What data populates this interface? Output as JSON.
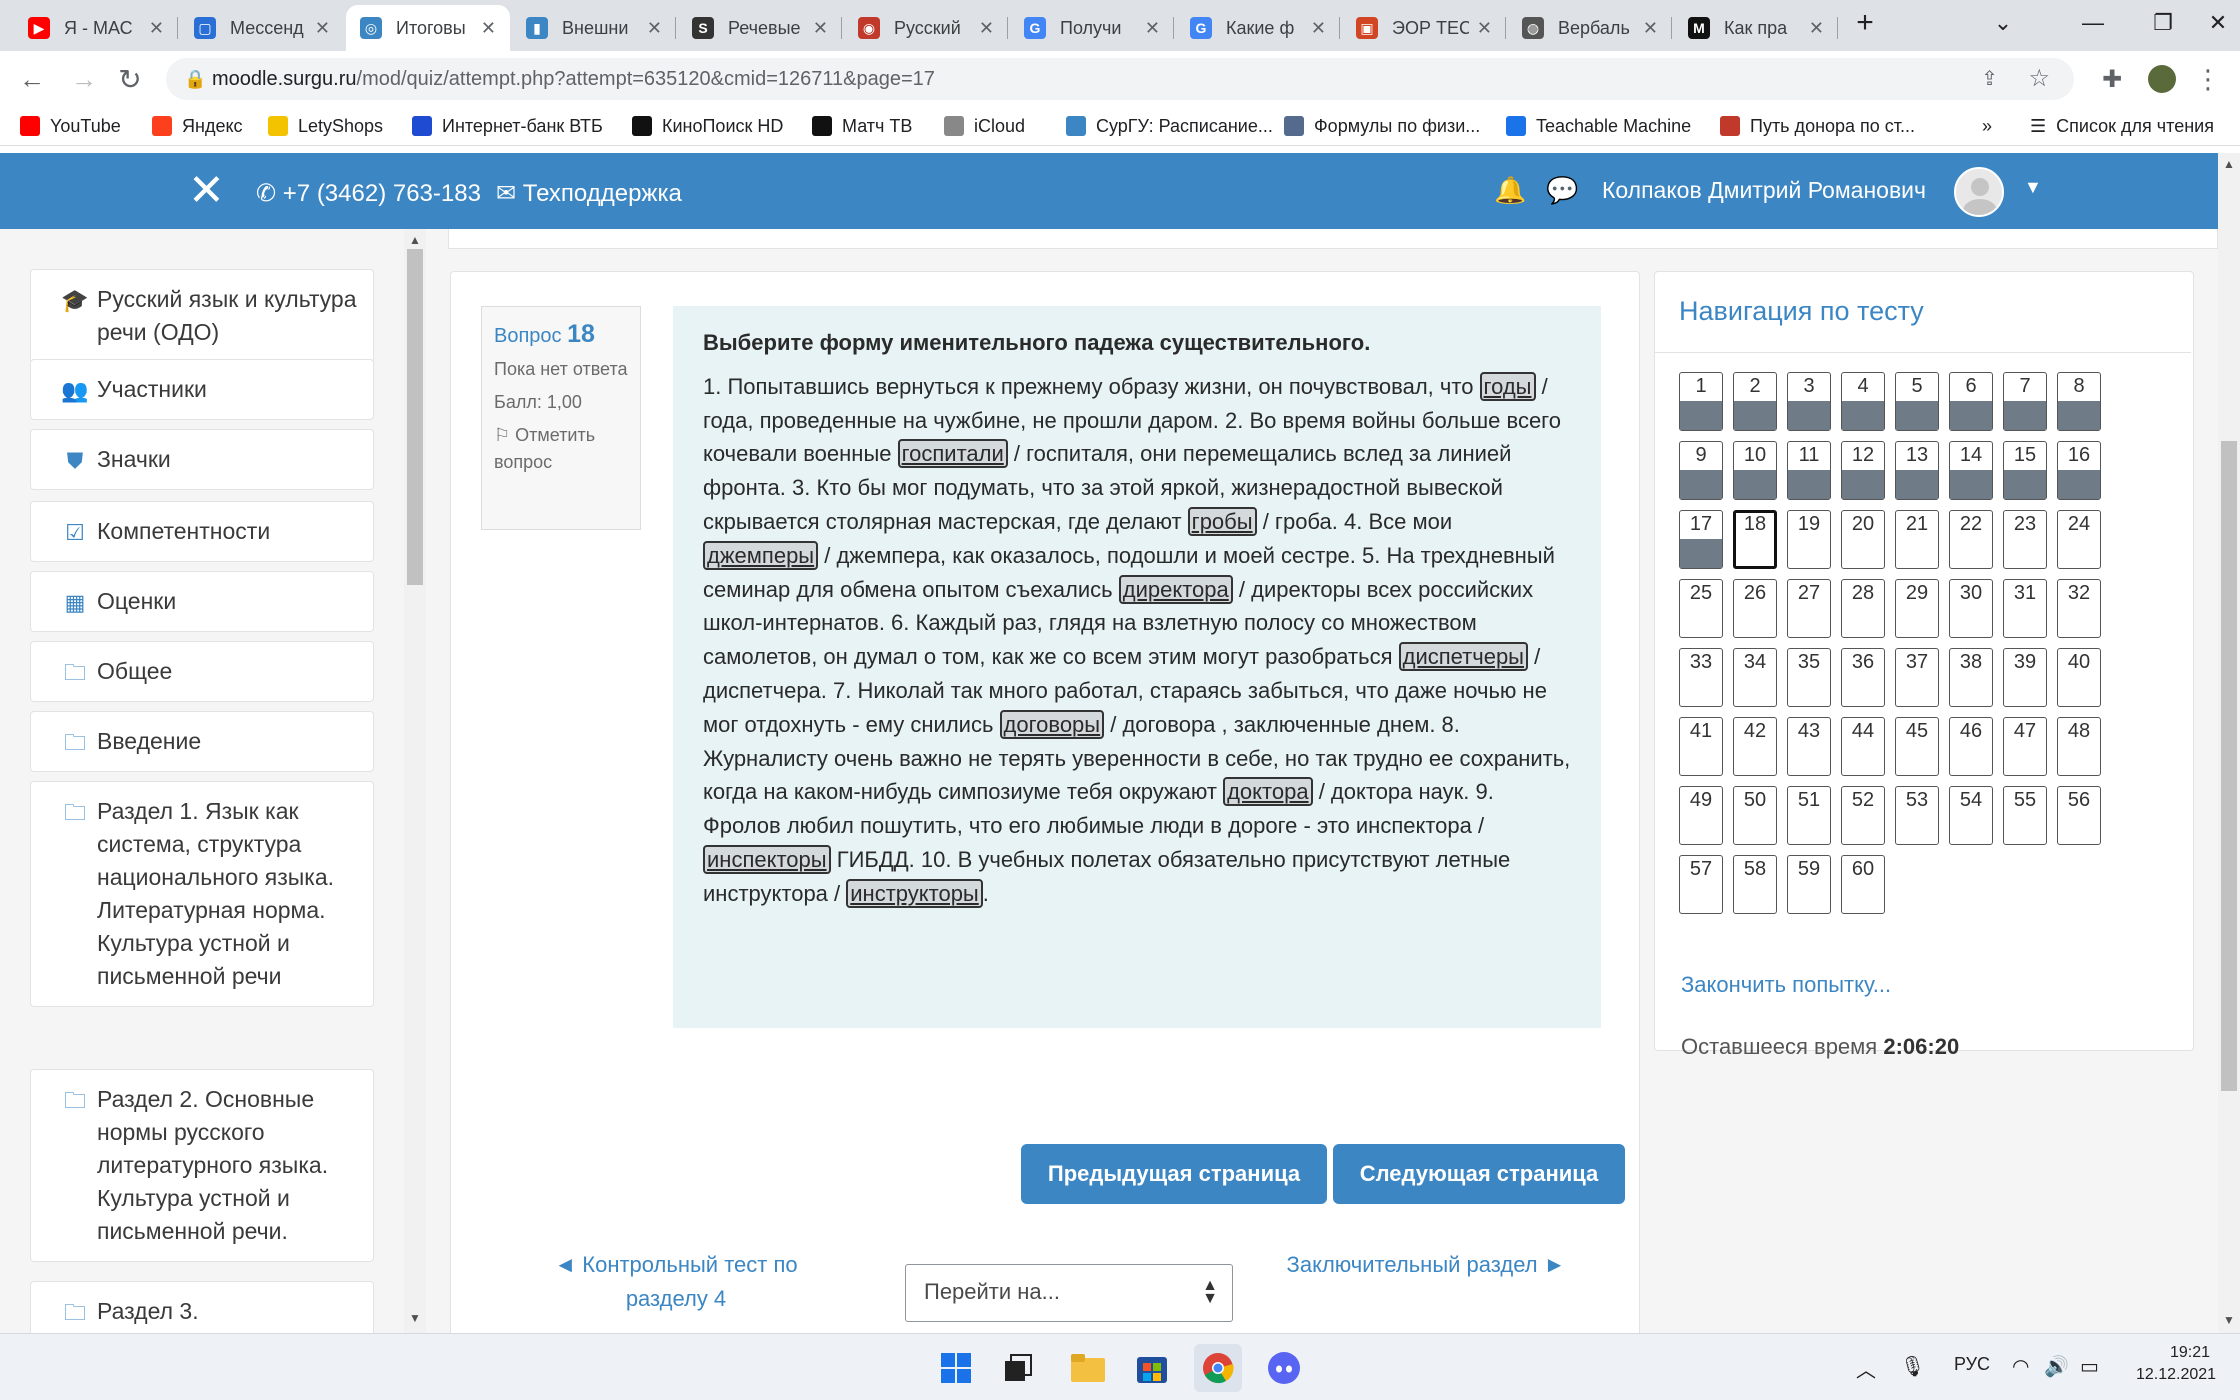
{
  "browser": {
    "tabs": [
      {
        "title": "Я - МАС",
        "color": "#ff0000",
        "glyph": "▶"
      },
      {
        "title": "Мессенд",
        "color": "#2a6fd6",
        "glyph": "▢"
      },
      {
        "title": "Итоговы",
        "color": "#3b86c3",
        "glyph": "◎"
      },
      {
        "title": "Внешни",
        "color": "#3b86c3",
        "glyph": "▮"
      },
      {
        "title": "Речевые",
        "color": "#333333",
        "glyph": "S"
      },
      {
        "title": "Русский",
        "color": "#c0392b",
        "glyph": "◉"
      },
      {
        "title": "Получи",
        "color": "#4285f4",
        "glyph": "G"
      },
      {
        "title": "Какие ф",
        "color": "#4285f4",
        "glyph": "G"
      },
      {
        "title": "ЭОР ТЕС",
        "color": "#d14424",
        "glyph": "▣"
      },
      {
        "title": "Вербаль",
        "color": "#555555",
        "glyph": "◍"
      },
      {
        "title": "Как пра",
        "color": "#111111",
        "glyph": "M"
      }
    ],
    "url_domain": "moodle.surgu.ru",
    "url_path": "/mod/quiz/attempt.php?attempt=635120&cmid=126711&page=17",
    "bookmarks": [
      {
        "label": "YouTube",
        "color": "#ff0000"
      },
      {
        "label": "Яндекс",
        "color": "#fc3f1d"
      },
      {
        "label": "LetyShops",
        "color": "#f4c300"
      },
      {
        "label": "Интернет-банк ВТБ",
        "color": "#1e4bd2"
      },
      {
        "label": "КиноПоиск HD",
        "color": "#111111"
      },
      {
        "label": "Матч ТВ",
        "color": "#111111"
      },
      {
        "label": "iCloud",
        "color": "#888888"
      },
      {
        "label": "СурГУ: Расписание...",
        "color": "#3b86c3"
      },
      {
        "label": "Формулы по физи...",
        "color": "#556b8d"
      },
      {
        "label": "Teachable Machine",
        "color": "#1a73e8"
      },
      {
        "label": "Путь донора по ст...",
        "color": "#c0392b"
      }
    ],
    "reading_list": "Список для чтения"
  },
  "header": {
    "phone": "+7 (3462) 763-183",
    "support": "Техподдержка",
    "user": "Колпаков Дмитрий Романович"
  },
  "sidebar": [
    {
      "icon": "graduation-cap-icon",
      "glyph": "🎓",
      "label": "Русский язык и культура речи (ОДО)"
    },
    {
      "icon": "users-icon",
      "glyph": "👥",
      "label": "Участники"
    },
    {
      "icon": "shield-icon",
      "glyph": "⛊",
      "label": "Значки"
    },
    {
      "icon": "checkbox-icon",
      "glyph": "☑",
      "label": "Компетентности"
    },
    {
      "icon": "table-icon",
      "glyph": "▦",
      "label": "Оценки"
    },
    {
      "icon": "folder-icon",
      "glyph": "🗀",
      "label": "Общее"
    },
    {
      "icon": "folder-icon",
      "glyph": "🗀",
      "label": "Введение"
    },
    {
      "icon": "folder-icon",
      "glyph": "🗀",
      "label": "Раздел 1. Язык как система, структура национального языка. Литературная норма. Культура устной и письменной речи"
    },
    {
      "icon": "folder-icon",
      "glyph": "🗀",
      "label": "Раздел 2. Основные нормы русского литературного языка. Культура устной и письменной речи."
    },
    {
      "icon": "folder-icon",
      "glyph": "🗀",
      "label": "Раздел 3."
    }
  ],
  "question": {
    "label": "Вопрос",
    "number": "18",
    "state": "Пока нет ответа",
    "grade": "Балл: 1,00",
    "flag": "Отметить вопрос",
    "title": "Выберите форму именительного падежа существительного.",
    "segments": [
      {
        "t": "   1. Попытавшись вернуться к прежнему образу жизни, он почувствовал, что "
      },
      {
        "t": "годы",
        "sel": true
      },
      {
        "t": " / года, проведенные на чужбине, не прошли даром. 2. Во время войны больше всего кочевали военные "
      },
      {
        "t": "госпитали",
        "sel": true
      },
      {
        "t": "  /  госпиталя, они перемещались вслед за линией фронта. 3. Кто бы мог подумать, что за этой яркой, жизнерадостной вывеской скрывается столярная мастерская, где делают "
      },
      {
        "t": "гробы",
        "sel": true
      },
      {
        "t": " / гроба. 4. Все мои "
      },
      {
        "t": "джемперы",
        "sel": true
      },
      {
        "t": " / джемпера, как оказалось, подошли и моей сестре. 5. На трехдневный семинар для обмена опытом съехались "
      },
      {
        "t": "директора",
        "sel": true
      },
      {
        "t": " / директоры всех российских школ-интернатов. 6. Каждый раз, глядя на взлетную полосу со множеством самолетов, он думал о том, как же со всем этим могут разобраться "
      },
      {
        "t": "диспетчеры",
        "sel": true
      },
      {
        "t": "  / диспетчера. 7. Николай так много работал, стараясь забыться, что даже ночью не мог отдохнуть - ему снились  "
      },
      {
        "t": "договоры",
        "sel": true
      },
      {
        "t": " / договора , заключенные днем. 8. Журналисту очень важно не терять уверенности в себе, но так трудно ее сохранить, когда на каком-нибудь симпозиуме тебя окружают  "
      },
      {
        "t": "доктора",
        "sel": true
      },
      {
        "t": " / доктора  наук. 9. Фролов любил пошутить, что его любимые люди в дороге - это  инспектора  / "
      },
      {
        "t": "инспекторы",
        "sel": true
      },
      {
        "t": "  ГИБДД. 10. В учебных полетах обязательно присутствуют летные  инструктора / "
      },
      {
        "t": "инструкторы",
        "sel": true
      },
      {
        "t": "."
      }
    ]
  },
  "buttons": {
    "prev": "Предыдущая страница",
    "next": "Следующая страница"
  },
  "footer": {
    "prev_link": "◄ Контрольный тест по разделу 4",
    "jump": "Перейти на...",
    "next_link": "Заключительный раздел ►"
  },
  "quiz_nav": {
    "title": "Навигация по тесту",
    "total": 60,
    "answered": [
      1,
      2,
      3,
      4,
      5,
      6,
      7,
      8,
      9,
      10,
      11,
      12,
      13,
      14,
      15,
      16,
      17
    ],
    "current": 18,
    "finish": "Закончить попытку...",
    "time_label": "Оставшееся время",
    "time_value": "2:06:20"
  },
  "taskbar": {
    "lang": "РУС",
    "time": "19:21",
    "date": "12.12.2021"
  }
}
